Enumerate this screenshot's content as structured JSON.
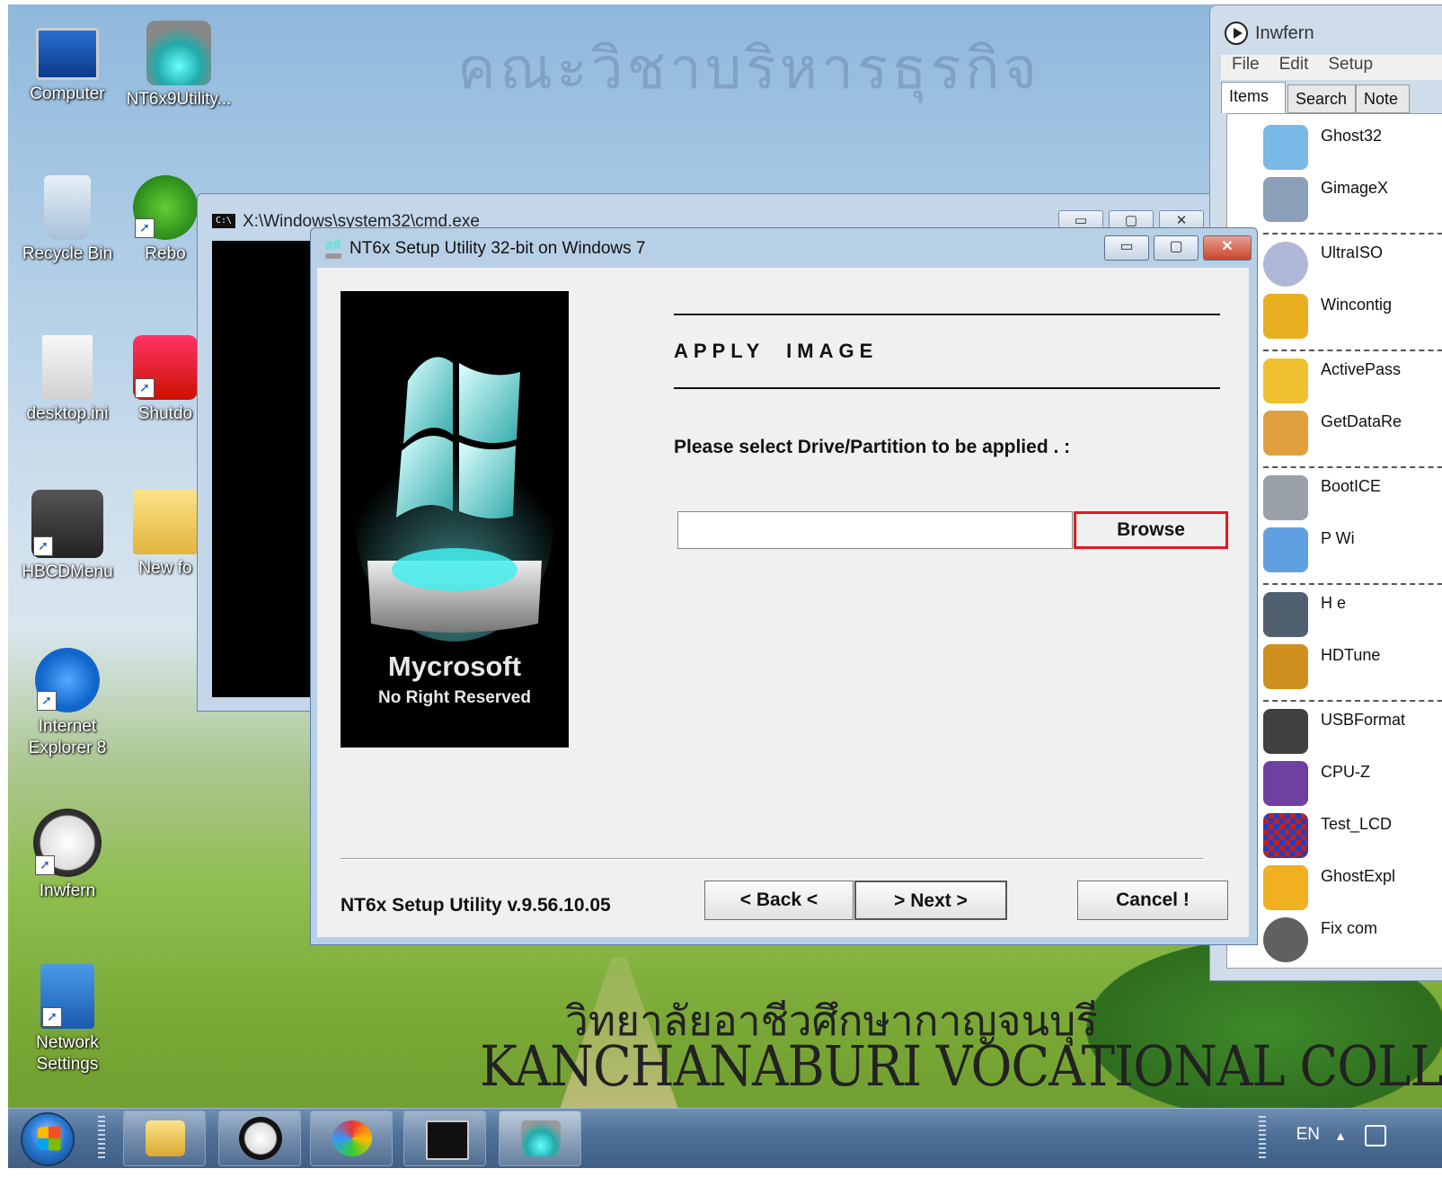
{
  "wallpaper": {
    "banner_text": "คณะวิชาบริหารธุรกิจ",
    "thai_text": "วิทยาลัยอาชีวศึกษากาญจนบุรี",
    "college_text": "KANCHANABURI VOCATIONAL COLLEGE"
  },
  "desktop_icons": [
    {
      "label": "Computer",
      "icon": "computer-icon"
    },
    {
      "label": "NT6x9Utility...",
      "icon": "nt6-utility-icon"
    },
    {
      "label": "Recycle Bin",
      "icon": "recycle-bin-icon"
    },
    {
      "label": "Rebo",
      "icon": "reboot-icon"
    },
    {
      "label": "desktop.ini",
      "icon": "settings-file-icon"
    },
    {
      "label": "Shutdo",
      "icon": "shutdown-icon"
    },
    {
      "label": "HBCDMenu",
      "icon": "tools-icon"
    },
    {
      "label": "New fo",
      "icon": "folder-icon"
    },
    {
      "label": "Internet",
      "label2": "Explorer 8",
      "icon": "internet-explorer-icon"
    },
    {
      "label": "Inwfern",
      "icon": "play-icon"
    },
    {
      "label": "Network",
      "label2": "Settings",
      "icon": "network-icon"
    }
  ],
  "cmd_window": {
    "title": "X:\\Windows\\system32\\cmd.exe",
    "icon_text": "C:\\"
  },
  "setup_dialog": {
    "title": "NT6x Setup Utility 32-bit on Windows 7",
    "minimize": "▭",
    "maximize": "▢",
    "close": "✕",
    "brand": "Mycrosoft",
    "brand_sub": "No Right Reserved",
    "heading": "APPLY  IMAGE",
    "prompt": "Please select Drive/Partition to be applied . :",
    "path_value": "",
    "browse_label": "Browse",
    "version": "NT6x Setup Utility v.9.56.10.05",
    "back_label": "< Back <",
    "next_label": "> Next >",
    "cancel_label": "Cancel !"
  },
  "inwfern": {
    "title": "Inwfern",
    "menu": [
      "File",
      "Edit",
      "Setup"
    ],
    "tabs": [
      "Items",
      "Search",
      "Note"
    ],
    "items": [
      {
        "label": "Ghost32",
        "color": "#7ab8e8"
      },
      {
        "label": "GimageX",
        "color": "#8aa0b8"
      },
      {
        "label": "UltraISO",
        "color": "#b0b8d8"
      },
      {
        "label": "Wincontig",
        "color": "#e8b020"
      },
      {
        "label": "ActivePass",
        "color": "#f0c030"
      },
      {
        "label": "GetDataRe",
        "color": "#e0a040"
      },
      {
        "label": "BootICE",
        "color": "#9aa0a8"
      },
      {
        "label": "P           Wi",
        "color": "#60a0e0"
      },
      {
        "label": "H          e",
        "color": "#506070"
      },
      {
        "label": "HDTune",
        "color": "#d09020"
      },
      {
        "label": "USBFormat",
        "color": "#404040"
      },
      {
        "label": "CPU-Z",
        "color": "#7040a0"
      },
      {
        "label": "Test_LCD",
        "color": "#c02020"
      },
      {
        "label": "GhostExpl",
        "color": "#f0b020"
      },
      {
        "label": "Fix com",
        "color": "#606060"
      }
    ]
  },
  "taskbar": {
    "language": "EN",
    "tray_arrow": "▲"
  }
}
